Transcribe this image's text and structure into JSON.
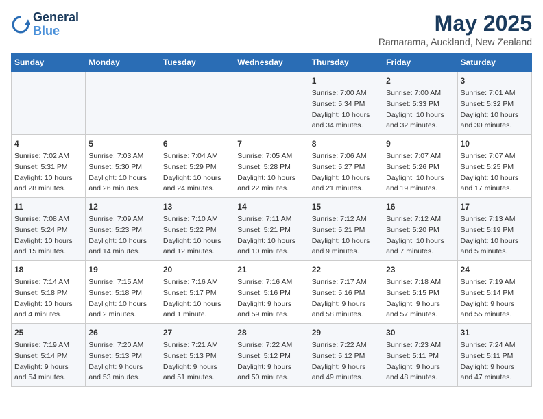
{
  "logo": {
    "line1": "General",
    "line2": "Blue"
  },
  "title": "May 2025",
  "location": "Ramarama, Auckland, New Zealand",
  "days_of_week": [
    "Sunday",
    "Monday",
    "Tuesday",
    "Wednesday",
    "Thursday",
    "Friday",
    "Saturday"
  ],
  "weeks": [
    [
      {
        "day": "",
        "info": ""
      },
      {
        "day": "",
        "info": ""
      },
      {
        "day": "",
        "info": ""
      },
      {
        "day": "",
        "info": ""
      },
      {
        "day": "1",
        "info": "Sunrise: 7:00 AM\nSunset: 5:34 PM\nDaylight: 10 hours\nand 34 minutes."
      },
      {
        "day": "2",
        "info": "Sunrise: 7:00 AM\nSunset: 5:33 PM\nDaylight: 10 hours\nand 32 minutes."
      },
      {
        "day": "3",
        "info": "Sunrise: 7:01 AM\nSunset: 5:32 PM\nDaylight: 10 hours\nand 30 minutes."
      }
    ],
    [
      {
        "day": "4",
        "info": "Sunrise: 7:02 AM\nSunset: 5:31 PM\nDaylight: 10 hours\nand 28 minutes."
      },
      {
        "day": "5",
        "info": "Sunrise: 7:03 AM\nSunset: 5:30 PM\nDaylight: 10 hours\nand 26 minutes."
      },
      {
        "day": "6",
        "info": "Sunrise: 7:04 AM\nSunset: 5:29 PM\nDaylight: 10 hours\nand 24 minutes."
      },
      {
        "day": "7",
        "info": "Sunrise: 7:05 AM\nSunset: 5:28 PM\nDaylight: 10 hours\nand 22 minutes."
      },
      {
        "day": "8",
        "info": "Sunrise: 7:06 AM\nSunset: 5:27 PM\nDaylight: 10 hours\nand 21 minutes."
      },
      {
        "day": "9",
        "info": "Sunrise: 7:07 AM\nSunset: 5:26 PM\nDaylight: 10 hours\nand 19 minutes."
      },
      {
        "day": "10",
        "info": "Sunrise: 7:07 AM\nSunset: 5:25 PM\nDaylight: 10 hours\nand 17 minutes."
      }
    ],
    [
      {
        "day": "11",
        "info": "Sunrise: 7:08 AM\nSunset: 5:24 PM\nDaylight: 10 hours\nand 15 minutes."
      },
      {
        "day": "12",
        "info": "Sunrise: 7:09 AM\nSunset: 5:23 PM\nDaylight: 10 hours\nand 14 minutes."
      },
      {
        "day": "13",
        "info": "Sunrise: 7:10 AM\nSunset: 5:22 PM\nDaylight: 10 hours\nand 12 minutes."
      },
      {
        "day": "14",
        "info": "Sunrise: 7:11 AM\nSunset: 5:21 PM\nDaylight: 10 hours\nand 10 minutes."
      },
      {
        "day": "15",
        "info": "Sunrise: 7:12 AM\nSunset: 5:21 PM\nDaylight: 10 hours\nand 9 minutes."
      },
      {
        "day": "16",
        "info": "Sunrise: 7:12 AM\nSunset: 5:20 PM\nDaylight: 10 hours\nand 7 minutes."
      },
      {
        "day": "17",
        "info": "Sunrise: 7:13 AM\nSunset: 5:19 PM\nDaylight: 10 hours\nand 5 minutes."
      }
    ],
    [
      {
        "day": "18",
        "info": "Sunrise: 7:14 AM\nSunset: 5:18 PM\nDaylight: 10 hours\nand 4 minutes."
      },
      {
        "day": "19",
        "info": "Sunrise: 7:15 AM\nSunset: 5:18 PM\nDaylight: 10 hours\nand 2 minutes."
      },
      {
        "day": "20",
        "info": "Sunrise: 7:16 AM\nSunset: 5:17 PM\nDaylight: 10 hours\nand 1 minute."
      },
      {
        "day": "21",
        "info": "Sunrise: 7:16 AM\nSunset: 5:16 PM\nDaylight: 9 hours\nand 59 minutes."
      },
      {
        "day": "22",
        "info": "Sunrise: 7:17 AM\nSunset: 5:16 PM\nDaylight: 9 hours\nand 58 minutes."
      },
      {
        "day": "23",
        "info": "Sunrise: 7:18 AM\nSunset: 5:15 PM\nDaylight: 9 hours\nand 57 minutes."
      },
      {
        "day": "24",
        "info": "Sunrise: 7:19 AM\nSunset: 5:14 PM\nDaylight: 9 hours\nand 55 minutes."
      }
    ],
    [
      {
        "day": "25",
        "info": "Sunrise: 7:19 AM\nSunset: 5:14 PM\nDaylight: 9 hours\nand 54 minutes."
      },
      {
        "day": "26",
        "info": "Sunrise: 7:20 AM\nSunset: 5:13 PM\nDaylight: 9 hours\nand 53 minutes."
      },
      {
        "day": "27",
        "info": "Sunrise: 7:21 AM\nSunset: 5:13 PM\nDaylight: 9 hours\nand 51 minutes."
      },
      {
        "day": "28",
        "info": "Sunrise: 7:22 AM\nSunset: 5:12 PM\nDaylight: 9 hours\nand 50 minutes."
      },
      {
        "day": "29",
        "info": "Sunrise: 7:22 AM\nSunset: 5:12 PM\nDaylight: 9 hours\nand 49 minutes."
      },
      {
        "day": "30",
        "info": "Sunrise: 7:23 AM\nSunset: 5:11 PM\nDaylight: 9 hours\nand 48 minutes."
      },
      {
        "day": "31",
        "info": "Sunrise: 7:24 AM\nSunset: 5:11 PM\nDaylight: 9 hours\nand 47 minutes."
      }
    ]
  ]
}
